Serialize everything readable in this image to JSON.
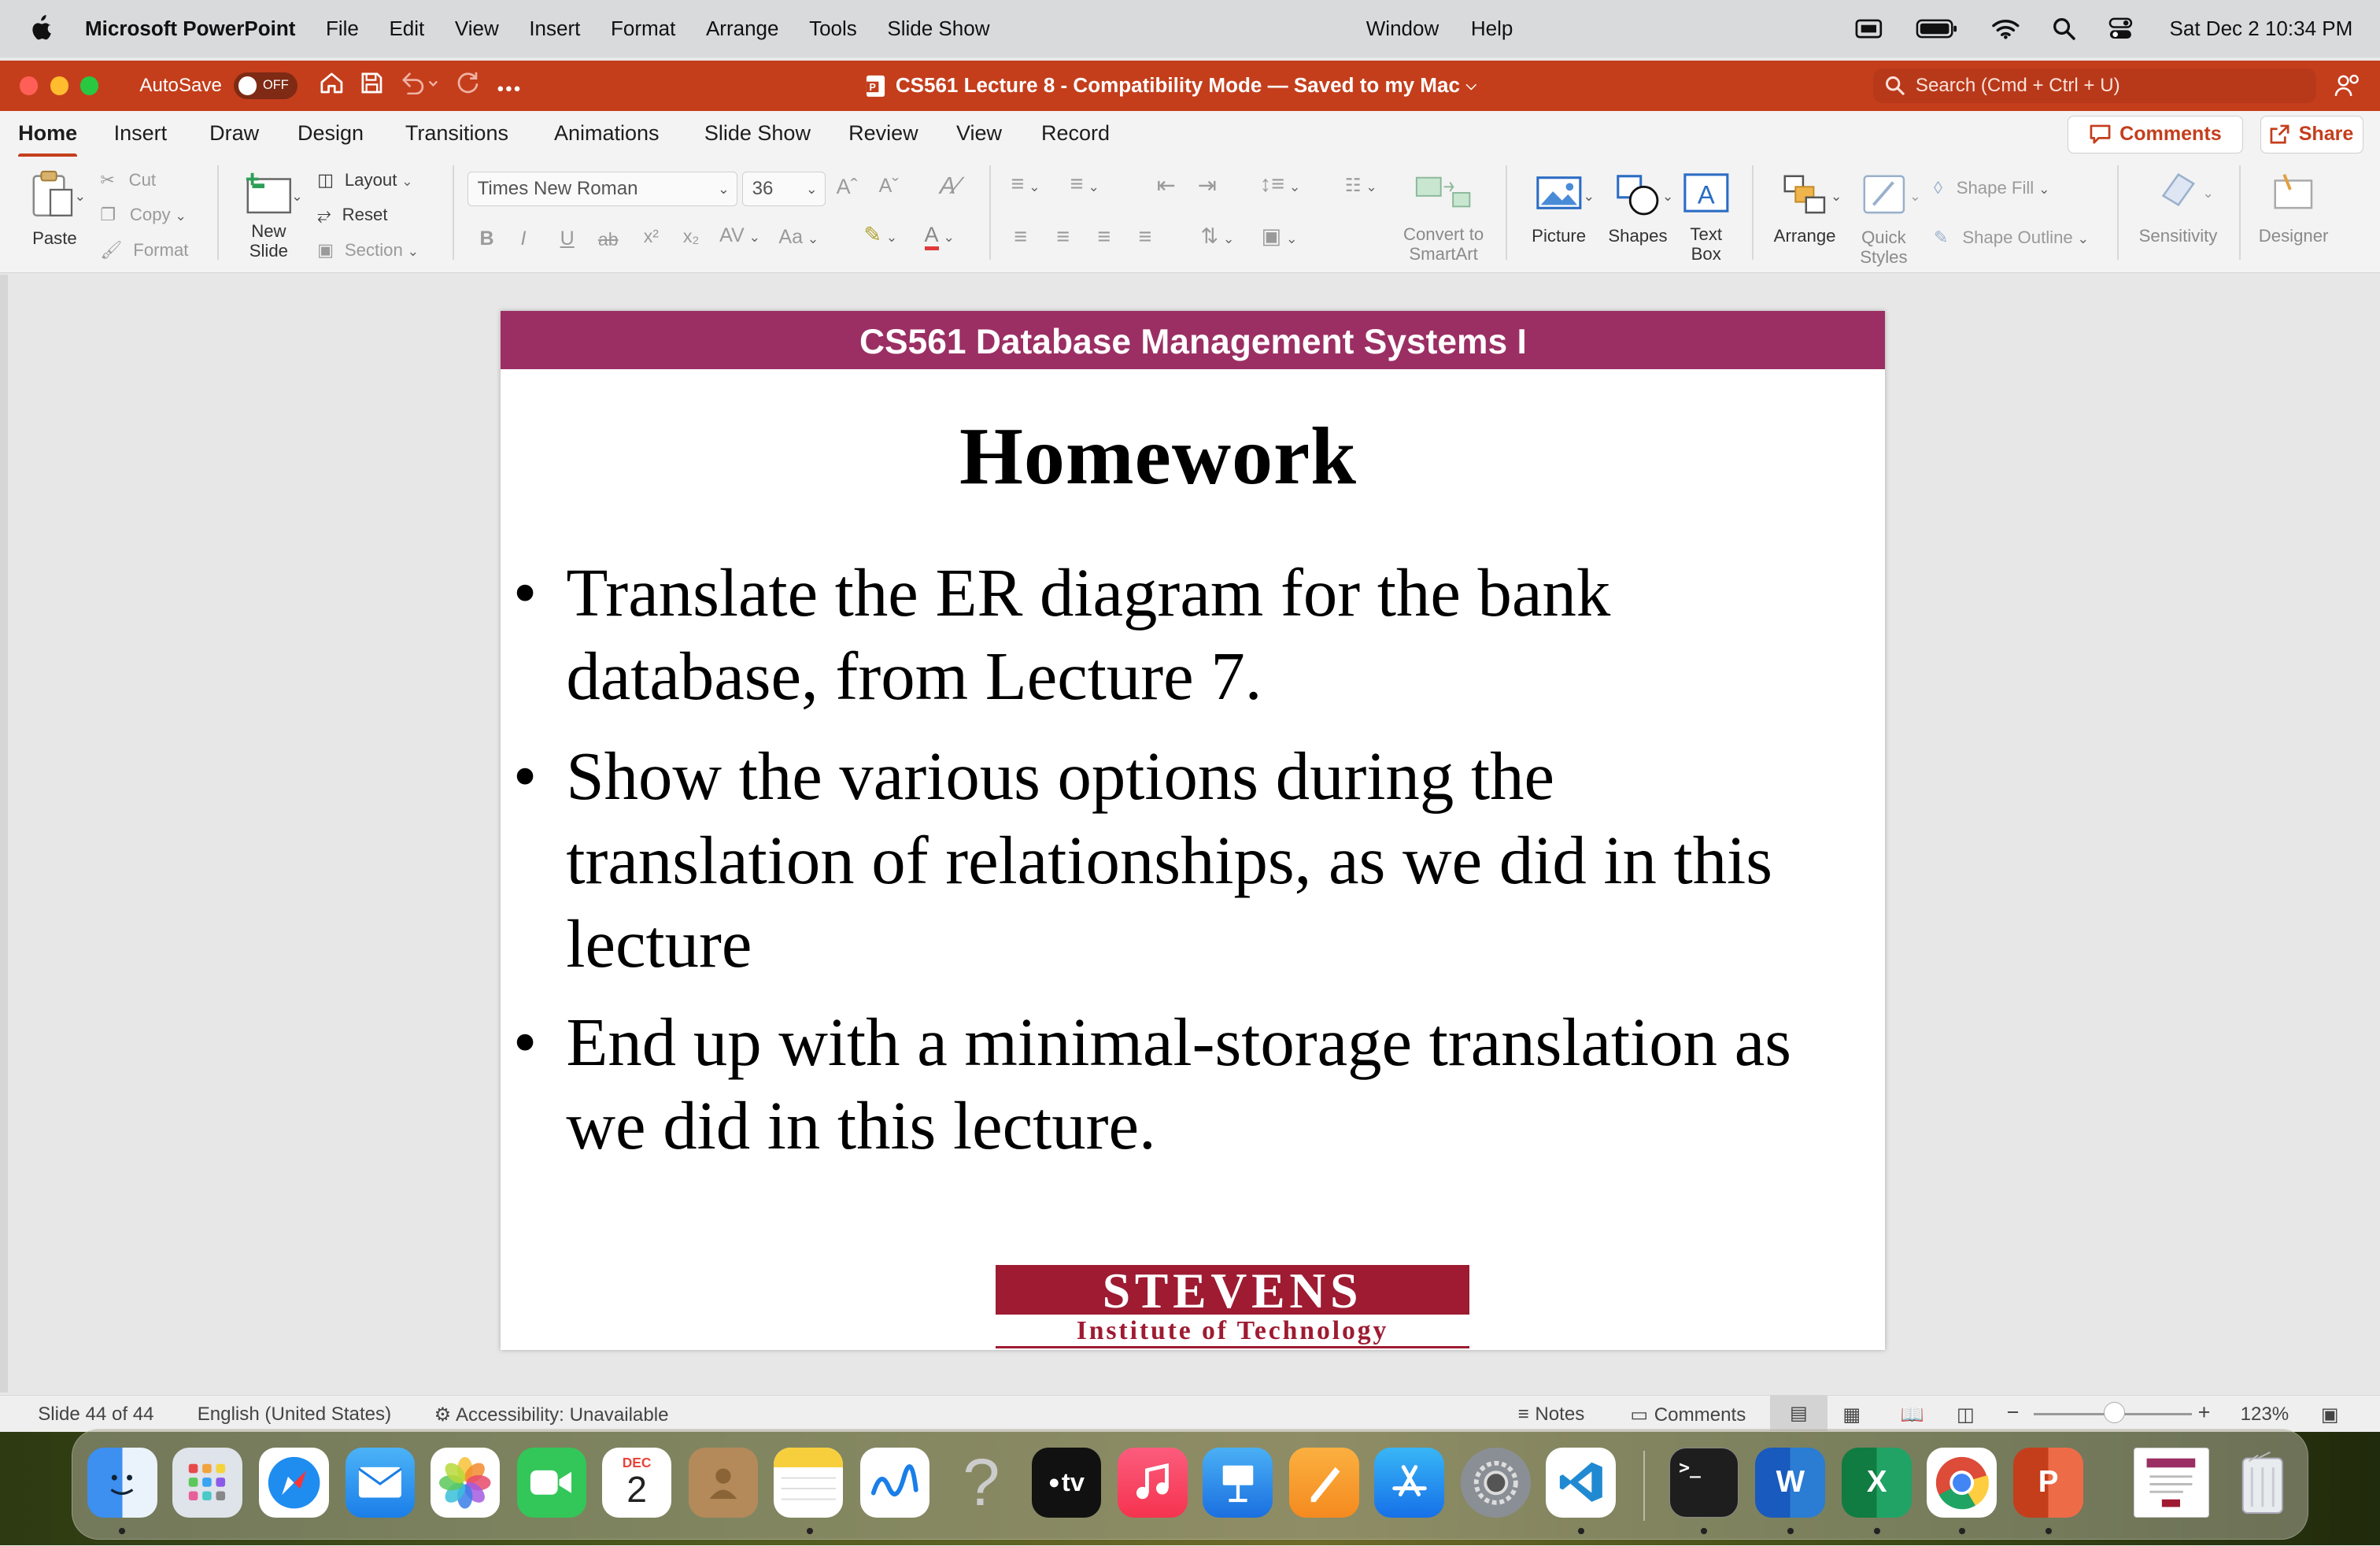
{
  "menubar": {
    "app_name": "Microsoft PowerPoint",
    "items": [
      "File",
      "Edit",
      "View",
      "Insert",
      "Format",
      "Arrange",
      "Tools",
      "Slide Show"
    ],
    "window": "Window",
    "help": "Help",
    "clock": "Sat Dec 2  10:34 PM"
  },
  "titlebar": {
    "autosave_label": "AutoSave",
    "autosave_state": "OFF",
    "document_title": "CS561 Lecture 8  -  Compatibility Mode — Saved to my Mac",
    "search_placeholder": "Search (Cmd + Ctrl + U)"
  },
  "ribbon_tabs": {
    "tabs": [
      "Home",
      "Insert",
      "Draw",
      "Design",
      "Transitions",
      "Animations",
      "Slide Show",
      "Review",
      "View",
      "Record"
    ],
    "active": "Home",
    "comments_label": "Comments",
    "share_label": "Share"
  },
  "ribbon": {
    "paste": "Paste",
    "cut": "Cut",
    "copy": "Copy",
    "format": "Format",
    "new_slide_1": "New",
    "new_slide_2": "Slide",
    "layout": "Layout",
    "reset": "Reset",
    "section": "Section",
    "font_name": "Times New Roman",
    "font_size": "36",
    "convert_smartart_1": "Convert to",
    "convert_smartart_2": "SmartArt",
    "picture": "Picture",
    "shapes": "Shapes",
    "text_box_1": "Text",
    "text_box_2": "Box",
    "arrange": "Arrange",
    "quick_styles_1": "Quick",
    "quick_styles_2": "Styles",
    "shape_fill": "Shape Fill",
    "shape_outline": "Shape Outline",
    "sensitivity": "Sensitivity",
    "designer": "Designer"
  },
  "slide": {
    "header": "CS561 Database Management Systems I",
    "title": "Homework",
    "bullets": [
      "Translate the ER diagram for the bank database, from Lecture 7.",
      "Show the various options during the translation of relationships, as we did in this lecture",
      "End up with a minimal-storage translation as we did in this lecture."
    ],
    "logo_top": "STEVENS",
    "logo_bottom": "Institute of Technology"
  },
  "statusbar": {
    "slide_counter": "Slide 44 of 44",
    "language": "English (United States)",
    "accessibility": "Accessibility: Unavailable",
    "notes": "Notes",
    "comments": "Comments",
    "zoom": "123%",
    "zoom_level_percent": 123
  },
  "dock": {
    "calendar_month": "DEC",
    "calendar_day": "2",
    "tv_label": "tv",
    "apps": [
      "finder",
      "launchpad",
      "safari",
      "mail",
      "photos",
      "facetime",
      "calendar",
      "contacts",
      "notes",
      "freeform",
      "unknown-app",
      "apple-tv",
      "music",
      "keynote",
      "pages",
      "app-store",
      "system-settings",
      "vscode",
      "terminal",
      "word",
      "excel",
      "chrome",
      "powerpoint",
      "document-thumbnail",
      "trash"
    ]
  },
  "colors": {
    "accent": "#c43e1c",
    "slide_header": "#9b2f64",
    "stevens_red": "#9e1b32"
  }
}
